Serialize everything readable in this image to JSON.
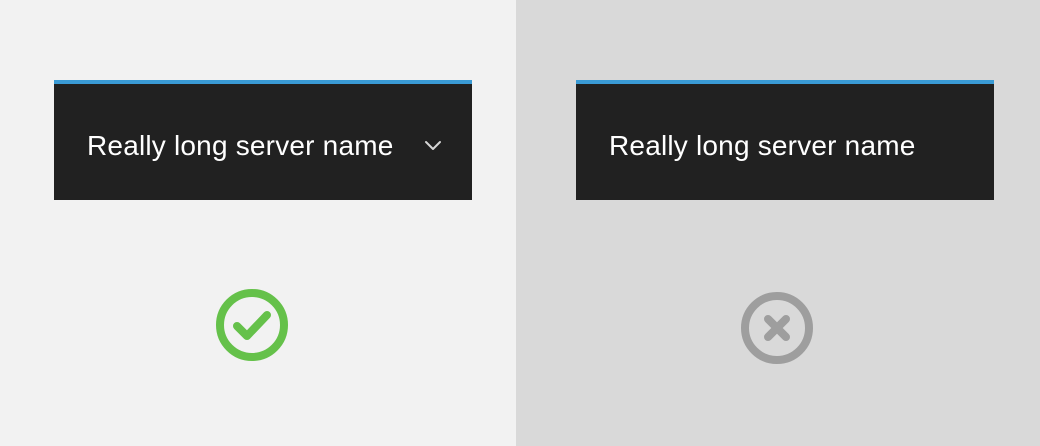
{
  "examples": [
    {
      "server_name": "Really long server name",
      "has_dropdown": true,
      "background": "#f2f2f2",
      "verdict_icon": "check-circle-icon",
      "verdict_color": "#65c14a"
    },
    {
      "server_name": "Really long server name",
      "has_dropdown": false,
      "background": "#d9d9d9",
      "verdict_icon": "x-circle-icon",
      "verdict_color": "#9e9e9e"
    }
  ],
  "colors": {
    "bar_background": "#212121",
    "bar_accent": "#3a9bd5",
    "text": "#ffffff"
  }
}
